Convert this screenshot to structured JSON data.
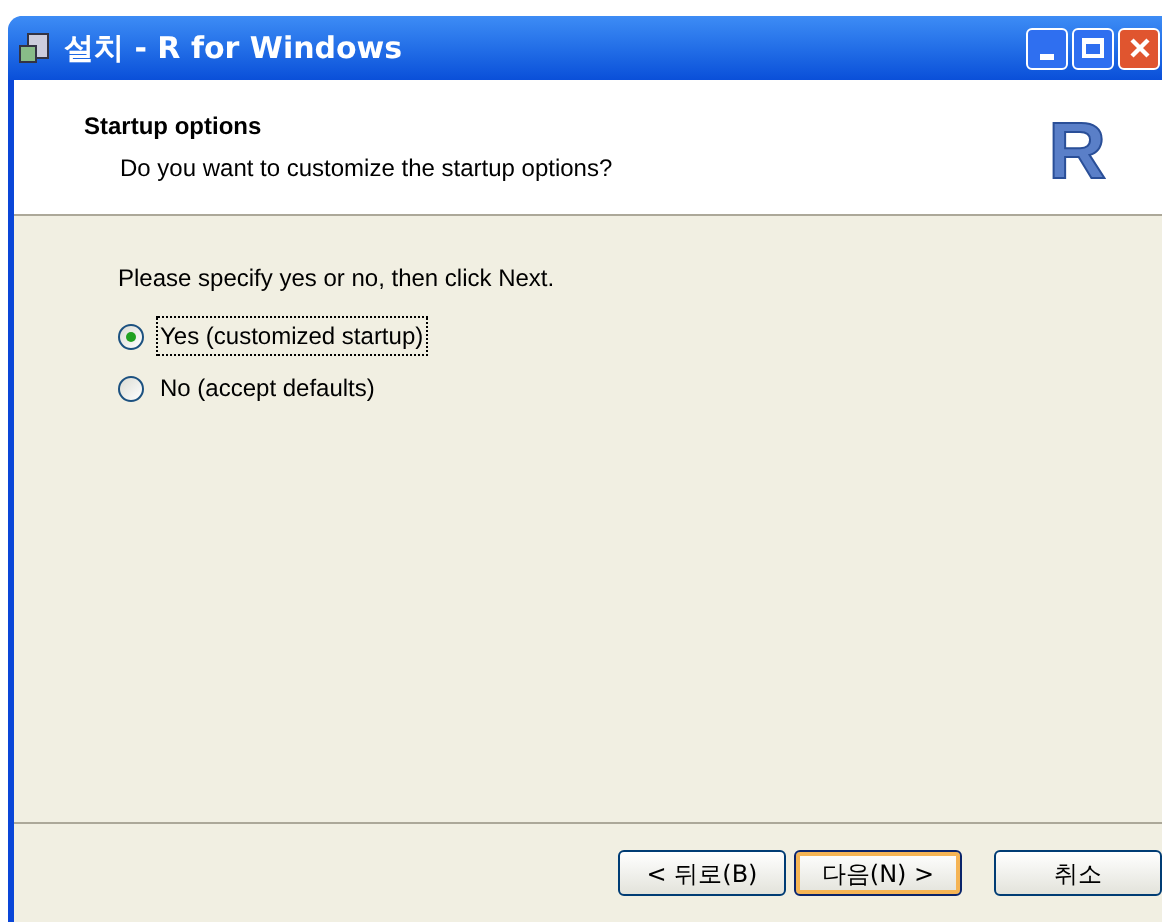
{
  "window": {
    "title": "설치 - R for Windows"
  },
  "header": {
    "title": "Startup options",
    "subtitle": "Do you want to customize the startup options?",
    "logo": "R"
  },
  "prompt": "Please specify yes or no, then click Next.",
  "options": [
    {
      "label": "Yes (customized startup)",
      "selected": true
    },
    {
      "label": "No (accept defaults)",
      "selected": false
    }
  ],
  "buttons": [
    {
      "label": "< 뒤로(B)",
      "kind": "back"
    },
    {
      "label": "다음(N) >",
      "kind": "default"
    },
    {
      "label": "취소",
      "kind": "cancel"
    }
  ]
}
